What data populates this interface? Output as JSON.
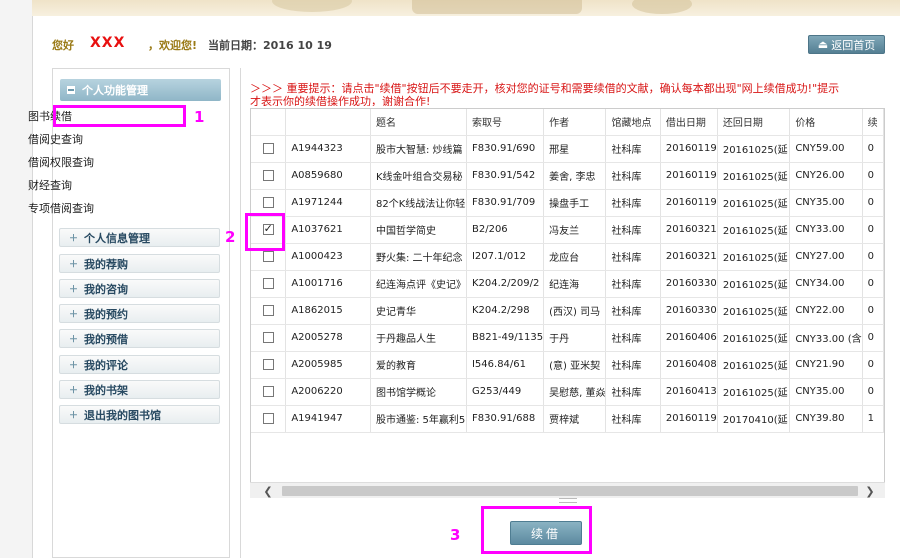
{
  "header": {
    "hello": "您好",
    "username": "XXX",
    "welcome": "，欢迎您!",
    "date_label": "当前日期：2016 10 19",
    "home_button": "返回首页"
  },
  "sidebar": {
    "section_title": "个人功能管理",
    "sub_items": [
      "图书续借",
      "借阅史查询",
      "借阅权限查询",
      "财经查询",
      "专项借阅查询"
    ],
    "menu": [
      "个人信息管理",
      "我的荐购",
      "我的咨询",
      "我的预约",
      "我的预借",
      "我的评论",
      "我的书架",
      "退出我的图书馆"
    ]
  },
  "notice": "＞＞＞ 重要提示：请点击\"续借\"按钮后不要走开，核对您的证号和需要续借的文献，确认每本都出现\"网上续借成功!\"提示才表示你的续借操作成功，谢谢合作!",
  "table": {
    "columns": [
      "",
      "",
      "题名",
      "索取号",
      "作者",
      "馆藏地点",
      "借出日期",
      "还回日期",
      "价格",
      "续"
    ],
    "rows": [
      {
        "checked": false,
        "barcode": "A1944323",
        "title": "股市大智慧: 炒线篇",
        "callno": "F830.91/690",
        "author": "邢星",
        "location": "社科库",
        "loan": "20160119",
        "due": "20161025(延",
        "price": "CNY59.00",
        "renew": "0"
      },
      {
        "checked": false,
        "barcode": "A0859680",
        "title": "K线金叶组合交易秘",
        "callno": "F830.91/542",
        "author": "姜舍, 李忠",
        "location": "社科库",
        "loan": "20160119",
        "due": "20161025(延",
        "price": "CNY26.00",
        "renew": "0"
      },
      {
        "checked": false,
        "barcode": "A1971244",
        "title": "82个K线战法让你轻",
        "callno": "F830.91/709",
        "author": "操盘手工",
        "location": "社科库",
        "loan": "20160119",
        "due": "20161025(延",
        "price": "CNY35.00",
        "renew": "0"
      },
      {
        "checked": true,
        "barcode": "A1037621",
        "title": "中国哲学简史",
        "callno": "B2/206",
        "author": "冯友兰",
        "location": "社科库",
        "loan": "20160321",
        "due": "20161025(延",
        "price": "CNY33.00",
        "renew": "0"
      },
      {
        "checked": false,
        "barcode": "A1000423",
        "title": "野火集: 二十年纪念",
        "callno": "I207.1/012",
        "author": "龙应台",
        "location": "社科库",
        "loan": "20160321",
        "due": "20161025(延",
        "price": "CNY27.00",
        "renew": "0"
      },
      {
        "checked": false,
        "barcode": "A1001716",
        "title": "纪连海点评《史记》",
        "callno": "K204.2/209/2",
        "author": "纪连海",
        "location": "社科库",
        "loan": "20160330",
        "due": "20161025(延",
        "price": "CNY34.00",
        "renew": "0"
      },
      {
        "checked": false,
        "barcode": "A1862015",
        "title": "史记青华",
        "callno": "K204.2/298",
        "author": "(西汉) 司马",
        "location": "社科库",
        "loan": "20160330",
        "due": "20161025(延",
        "price": "CNY22.00",
        "renew": "0"
      },
      {
        "checked": false,
        "barcode": "A2005278",
        "title": "于丹趣品人生",
        "callno": "B821-49/1135",
        "author": "于丹",
        "location": "社科库",
        "loan": "20160406",
        "due": "20161025(延",
        "price": "CNY33.00 (含",
        "renew": "0"
      },
      {
        "checked": false,
        "barcode": "A2005985",
        "title": "爱的教育",
        "callno": "I546.84/61",
        "author": "(意) 亚米契",
        "location": "社科库",
        "loan": "20160408",
        "due": "20161025(延",
        "price": "CNY21.90",
        "renew": "0"
      },
      {
        "checked": false,
        "barcode": "A2006220",
        "title": "图书馆学概论",
        "callno": "G253/449",
        "author": "吴慰慈, 董焱",
        "location": "社科库",
        "loan": "20160413",
        "due": "20161025(延",
        "price": "CNY35.00",
        "renew": "0"
      },
      {
        "checked": false,
        "barcode": "A1941947",
        "title": "股市通鉴: 5年赢利5",
        "callno": "F830.91/688",
        "author": "贾梓斌",
        "location": "社科库",
        "loan": "20160119",
        "due": "20170410(延",
        "price": "CNY39.80",
        "renew": "1"
      }
    ]
  },
  "renew_button": "续借",
  "markers": [
    "1",
    "2",
    "3"
  ],
  "colors": {
    "highlight": "#ff00ff",
    "notice": "#d81414",
    "username": "#e81010",
    "accent": "#5c8aa0"
  }
}
